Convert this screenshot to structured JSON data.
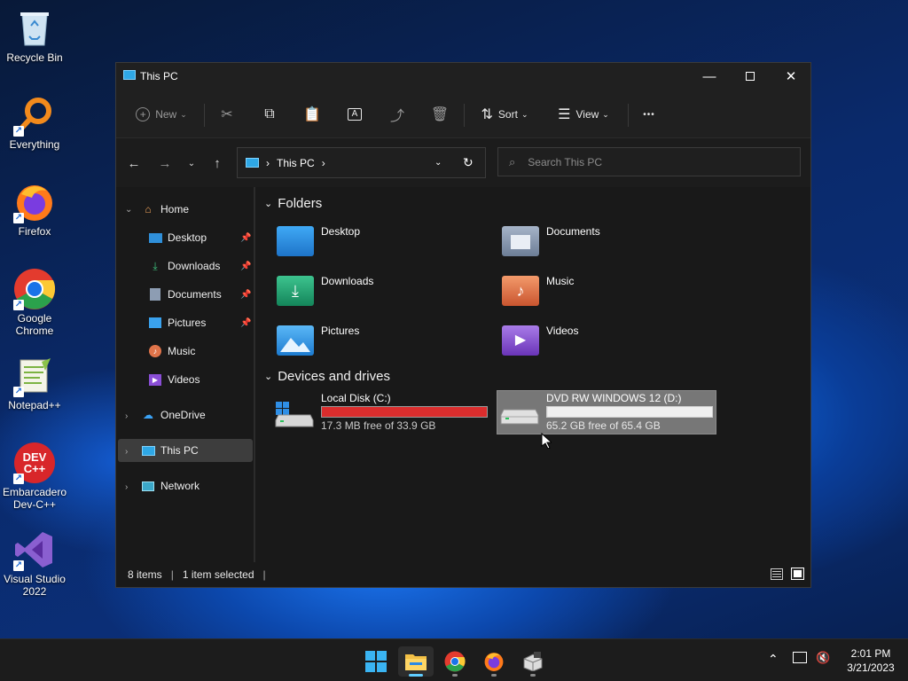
{
  "desktop": {
    "icons": [
      {
        "label": "Recycle Bin",
        "icon": "recycle-bin-icon"
      },
      {
        "label": "Everything",
        "icon": "everything-icon"
      },
      {
        "label": "Firefox",
        "icon": "firefox-icon"
      },
      {
        "label": "Google Chrome",
        "icon": "chrome-icon"
      },
      {
        "label": "Notepad++",
        "icon": "notepadpp-icon"
      },
      {
        "label": "Embarcadero Dev-C++",
        "icon": "devcpp-icon"
      },
      {
        "label": "Visual Studio 2022",
        "icon": "visual-studio-icon"
      }
    ],
    "devcpp_logo_text": "DEV C++"
  },
  "window": {
    "title": "This PC",
    "toolbar": {
      "new_label": "New",
      "sort_label": "Sort",
      "view_label": "View",
      "more_glyph": "•••"
    },
    "address": {
      "location": "This PC",
      "separator": "›"
    },
    "search": {
      "placeholder": "Search This PC"
    },
    "sidebar": {
      "home": "Home",
      "quick": [
        {
          "label": "Desktop",
          "icon": "desktop-icon",
          "pinned": true
        },
        {
          "label": "Downloads",
          "icon": "download-icon",
          "pinned": true
        },
        {
          "label": "Documents",
          "icon": "document-icon",
          "pinned": true
        },
        {
          "label": "Pictures",
          "icon": "picture-icon",
          "pinned": true
        },
        {
          "label": "Music",
          "icon": "music-icon",
          "pinned": false
        },
        {
          "label": "Videos",
          "icon": "video-icon",
          "pinned": false
        }
      ],
      "onedrive": "OneDrive",
      "thispc": "This PC",
      "network": "Network"
    },
    "content": {
      "folders_heading": "Folders",
      "folders": [
        {
          "label": "Desktop",
          "color": "#1e88d9"
        },
        {
          "label": "Documents",
          "color": "#7c8ea6"
        },
        {
          "label": "Downloads",
          "color": "#1fa873"
        },
        {
          "label": "Music",
          "color": "#e0744a"
        },
        {
          "label": "Pictures",
          "color": "#2f9ae6"
        },
        {
          "label": "Videos",
          "color": "#8a4ed6"
        }
      ],
      "drives_heading": "Devices and drives",
      "drives": [
        {
          "label": "Local Disk (C:)",
          "size": "17.3 MB free of 33.9 GB",
          "used_fraction": 0.999,
          "bar_color": "#da2d2d"
        },
        {
          "label": "DVD RW WINDOWS 12 (D:)",
          "size": "65.2 GB free of 65.4 GB",
          "used_fraction": 0.003,
          "bar_color": "#e6e6e6"
        }
      ]
    },
    "status": {
      "items": "8 items",
      "selected": "1 item selected"
    }
  },
  "taskbar": {
    "clock_time": "2:01 PM",
    "clock_date": "3/21/2023",
    "apps": [
      "start-icon",
      "file-explorer-icon",
      "chrome-icon",
      "firefox-icon",
      "installer-icon"
    ]
  },
  "colors": {
    "accent": "#60cdff",
    "selection": "#454545"
  }
}
